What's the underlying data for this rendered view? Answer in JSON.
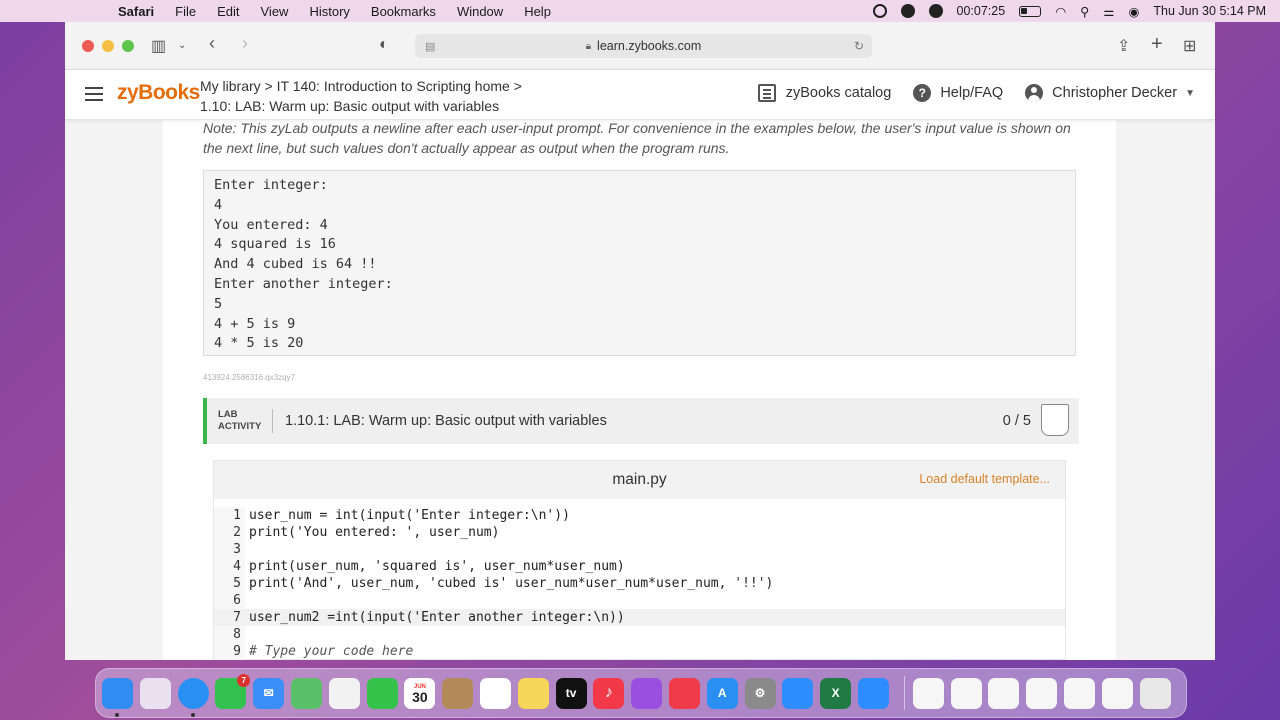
{
  "menubar": {
    "app": "Safari",
    "items": [
      "File",
      "Edit",
      "View",
      "History",
      "Bookmarks",
      "Window",
      "Help"
    ],
    "timer": "00:07:25",
    "datetime": "Thu Jun 30  5:14 PM"
  },
  "browser": {
    "url": "learn.zybooks.com"
  },
  "header": {
    "logo": "zyBooks",
    "breadcrumb_line1": "My library > IT 140: Introduction to Scripting home >",
    "breadcrumb_line2": "1.10: LAB: Warm up: Basic output with variables",
    "catalog": "zyBooks catalog",
    "help": "Help/FAQ",
    "user": "Christopher Decker"
  },
  "content": {
    "note": "Note: This zyLab outputs a newline after each user-input prompt. For convenience in the examples below, the user's input value is shown on the next line, but such values don't actually appear as output when the program runs.",
    "sample_output": [
      "Enter integer:",
      "4",
      "You entered: 4",
      "4 squared is 16",
      "And 4 cubed is 64 !!",
      "Enter another integer:",
      "5",
      "4 + 5 is 9",
      "4 * 5 is 20"
    ],
    "activity_id": "413924.2586316.qx3zqy7"
  },
  "lab": {
    "tag_line1": "LAB",
    "tag_line2": "ACTIVITY",
    "title": "1.10.1: LAB: Warm up: Basic output with variables",
    "score": "0 / 5"
  },
  "editor": {
    "filename": "main.py",
    "load_template": "Load default template...",
    "lines": [
      {
        "n": "1",
        "code": "user_num = int(input('Enter integer:\\n'))"
      },
      {
        "n": "2",
        "code": "print('You entered: ', user_num)"
      },
      {
        "n": "3",
        "code": ""
      },
      {
        "n": "4",
        "code": "print(user_num, 'squared is', user_num*user_num)"
      },
      {
        "n": "5",
        "code": "print('And', user_num, 'cubed is' user_num*user_num*user_num, '!!')"
      },
      {
        "n": "6",
        "code": ""
      },
      {
        "n": "7",
        "code": "user_num2 =int(input('Enter another integer:\\n))"
      },
      {
        "n": "8",
        "code": ""
      },
      {
        "n": "9",
        "code": "# Type your code here"
      }
    ]
  },
  "dock": {
    "apps": [
      {
        "name": "finder-icon",
        "color": "#2f8cf0",
        "label": ""
      },
      {
        "name": "launchpad-icon",
        "color": "#e6e6e6",
        "label": ""
      },
      {
        "name": "safari-icon",
        "color": "#2a8ff2",
        "label": ""
      },
      {
        "name": "messages-icon",
        "color": "#33c24d",
        "label": "",
        "badge": "7"
      },
      {
        "name": "mail-icon",
        "color": "#3a8ef5",
        "label": ""
      },
      {
        "name": "maps-icon",
        "color": "#5bbf6a",
        "label": ""
      },
      {
        "name": "photos-icon",
        "color": "#f2f2f2",
        "label": ""
      },
      {
        "name": "facetime-icon",
        "color": "#34c24a",
        "label": ""
      },
      {
        "name": "calendar-icon",
        "color": "#ffffff",
        "label": "30"
      },
      {
        "name": "contacts-icon",
        "color": "#b48a5a",
        "label": ""
      },
      {
        "name": "reminders-icon",
        "color": "#ffffff",
        "label": ""
      },
      {
        "name": "notes-icon",
        "color": "#f7d659",
        "label": ""
      },
      {
        "name": "appletv-icon",
        "color": "#111111",
        "label": "tv"
      },
      {
        "name": "music-icon",
        "color": "#f2394a",
        "label": "♪"
      },
      {
        "name": "podcasts-icon",
        "color": "#9b4fe0",
        "label": ""
      },
      {
        "name": "news-icon",
        "color": "#f03b4a",
        "label": ""
      },
      {
        "name": "appstore-icon",
        "color": "#2a8ff2",
        "label": ""
      },
      {
        "name": "system-preferences-icon",
        "color": "#8a8a8a",
        "label": ""
      },
      {
        "name": "zoom-icon",
        "color": "#2d8cff",
        "label": ""
      },
      {
        "name": "excel-icon",
        "color": "#1f7a44",
        "label": "X"
      },
      {
        "name": "zoom-meeting-icon",
        "color": "#2d8cff",
        "label": ""
      }
    ],
    "calendar_month": "JUN"
  }
}
